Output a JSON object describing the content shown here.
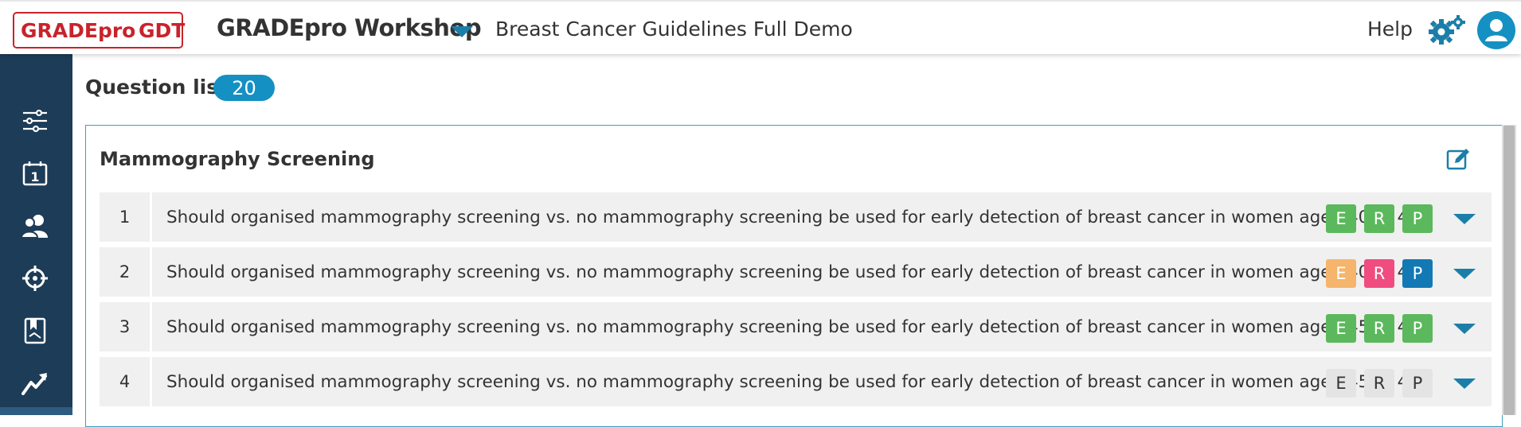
{
  "header": {
    "logo_left": "GRADEpro",
    "logo_right": "GDT",
    "workshop": "GRADEpro Workshop",
    "project": "Breast Cancer Guidelines Full Demo",
    "help": "Help"
  },
  "sidebar": {
    "items": [
      "sliders-icon",
      "calendar-icon",
      "team-icon",
      "target-icon",
      "document-icon",
      "trend-icon"
    ]
  },
  "question_list": {
    "title": "Question list",
    "count": "20"
  },
  "group": {
    "title": "Mammography Screening",
    "rows": [
      {
        "num": "1",
        "question": "Should organised mammography screening vs. no mammography screening be used for early detection of breast cancer in women aged 40 to 44?",
        "e": "E",
        "r": "R",
        "p": "P"
      },
      {
        "num": "2",
        "question": "Should organised mammography screening vs. no mammography screening be used for early detection of breast cancer in women aged 40 to 44?",
        "e": "E",
        "r": "R",
        "p": "P"
      },
      {
        "num": "3",
        "question": "Should organised mammography screening vs. no mammography screening be used for early detection of breast cancer in women aged 45 to 49?",
        "e": "E",
        "r": "R",
        "p": "P"
      },
      {
        "num": "4",
        "question": "Should organised mammography screening vs. no mammography screening be used for early detection of breast cancer in women aged 45 to 49?",
        "e": "E",
        "r": "R",
        "p": "P"
      }
    ]
  },
  "colors": {
    "sidebar": "#1c3c58",
    "accent": "#1b7ea9",
    "count_badge": "#1590c2",
    "status_green": "#5cb85c",
    "status_orange": "#f5b56c",
    "status_pink": "#f04c7f",
    "status_blue": "#1279b4",
    "status_grey": "#e4e4e4",
    "logo_red": "#c8232c"
  }
}
